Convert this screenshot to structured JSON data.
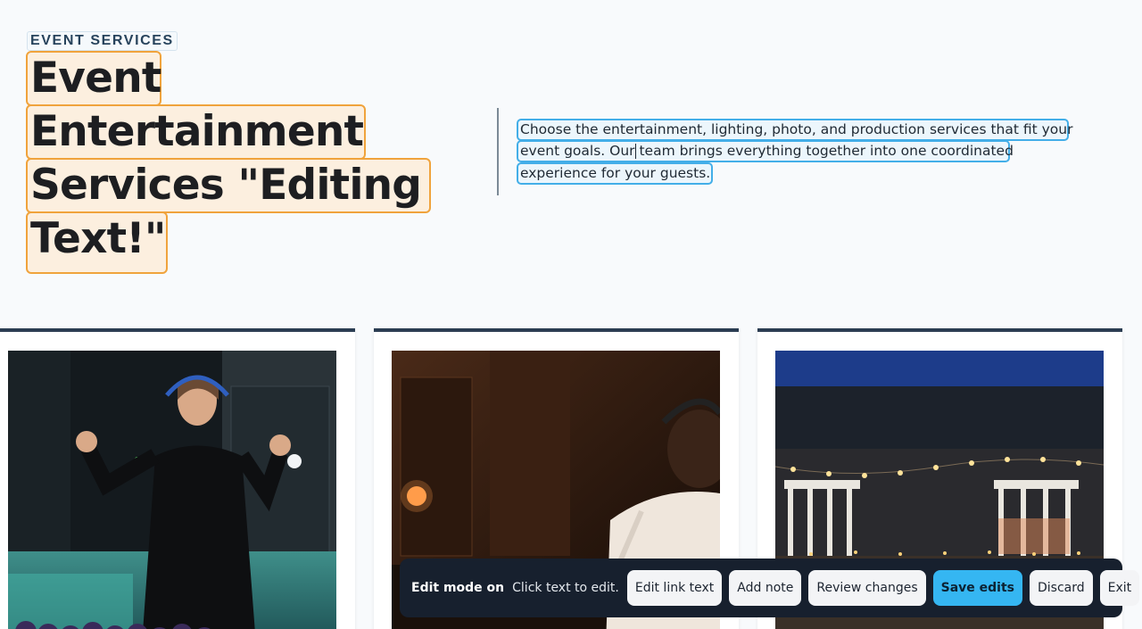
{
  "header": {
    "eyebrow": "EVENT SERVICES",
    "title_lines": [
      "Event",
      "Entertainment",
      "Services \"Editing",
      "Text!\""
    ]
  },
  "intro": {
    "lines": [
      "Choose the entertainment, lighting, photo, and production services that fit your",
      "event goals. Our team brings everything together into one coordinated",
      "experience for your guests."
    ]
  },
  "cards": [
    {
      "image": "woman-dancing-with-headphones-photo"
    },
    {
      "image": "dj-at-turntables-photo"
    },
    {
      "image": "outdoor-venue-string-lights-photo"
    }
  ],
  "toolbar": {
    "status": "Edit mode on",
    "hint": "Click text to edit.",
    "buttons": [
      "Edit link text",
      "Add note",
      "Review changes",
      "Save edits",
      "Discard",
      "Exit"
    ]
  },
  "colors": {
    "accent": "#35b6f2",
    "title_highlight_border": "#f0a33c",
    "title_highlight_fill": "#fcefdf",
    "text_highlight_border": "#43aee8",
    "toolbar_bg": "#17202e",
    "card_top_border": "#2b3d52"
  }
}
